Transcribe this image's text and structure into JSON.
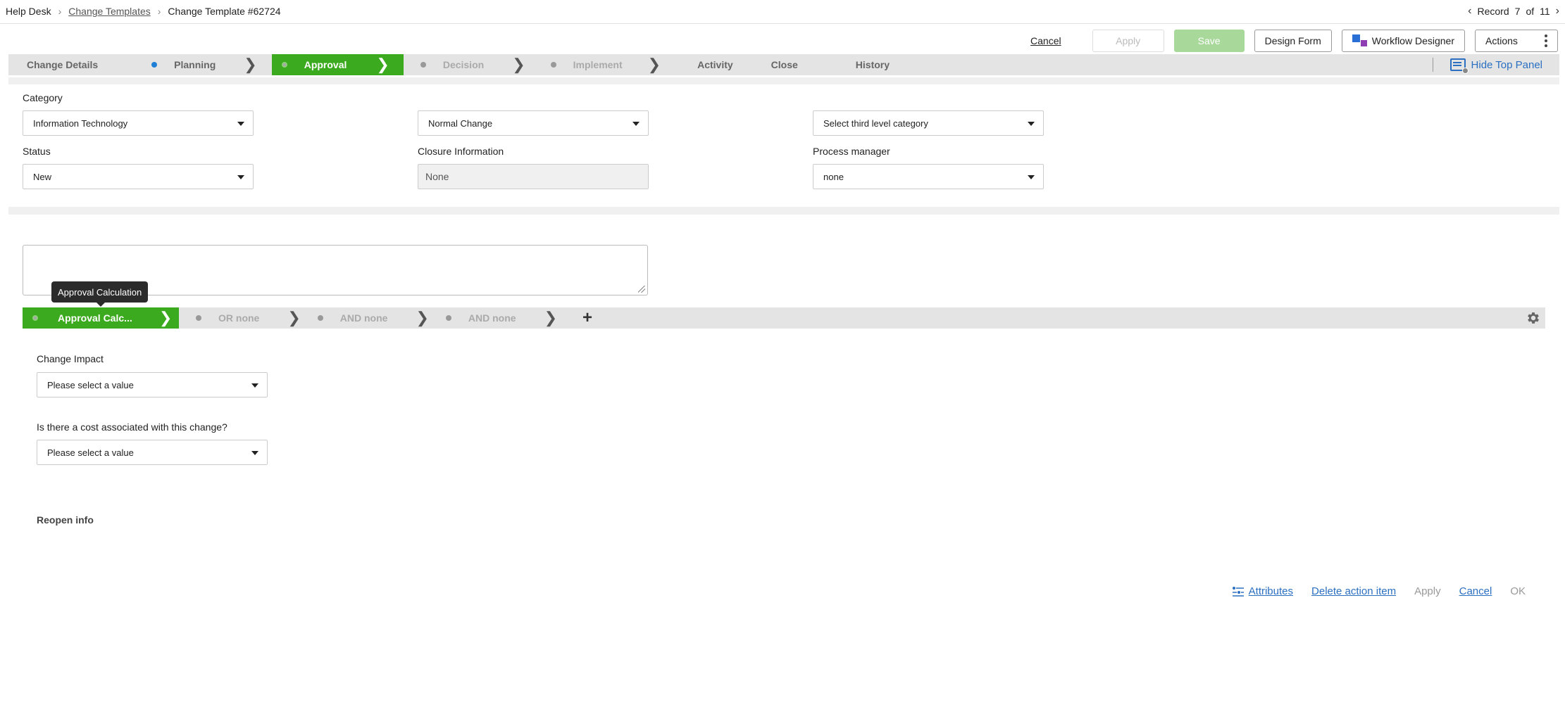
{
  "header": {
    "breadcrumb": [
      "Help Desk",
      "Change Templates",
      "Change Template #62724"
    ],
    "record_label": "Record",
    "record_index": "7",
    "record_of": "of",
    "record_total": "11"
  },
  "toolbar": {
    "cancel": "Cancel",
    "apply": "Apply",
    "save": "Save",
    "design_form": "Design Form",
    "workflow_designer": "Workflow Designer",
    "actions": "Actions"
  },
  "tabs": [
    {
      "label": "Change Details"
    },
    {
      "label": "Planning"
    },
    {
      "label": "Approval"
    },
    {
      "label": "Decision"
    },
    {
      "label": "Implement"
    },
    {
      "label": "Activity"
    },
    {
      "label": "Close"
    },
    {
      "label": "History"
    }
  ],
  "hide_top_panel": "Hide Top Panel",
  "form": {
    "category_label": "Category",
    "category_value": "Information Technology",
    "category2_value": "Normal Change",
    "category3_value": "Select third level category",
    "status_label": "Status",
    "status_value": "New",
    "closure_label": "Closure Information",
    "closure_value": "None",
    "process_manager_label": "Process manager",
    "process_manager_value": "none"
  },
  "tooltip": "Approval Calculation",
  "sub_stages": [
    {
      "label": "Approval Calc..."
    },
    {
      "label": "OR none"
    },
    {
      "label": "AND none"
    },
    {
      "label": "AND none"
    }
  ],
  "approval_form": {
    "change_impact_label": "Change Impact",
    "change_impact_value": "Please select a value",
    "cost_label": "Is there a cost associated with this change?",
    "cost_value": "Please select a value",
    "reopen_label": "Reopen info"
  },
  "footer": {
    "attributes": "Attributes",
    "delete": "Delete action item",
    "apply": "Apply",
    "cancel": "Cancel",
    "ok": "OK"
  },
  "colors": {
    "accent_green": "#3caa1e",
    "link_blue": "#2b6fc1"
  }
}
